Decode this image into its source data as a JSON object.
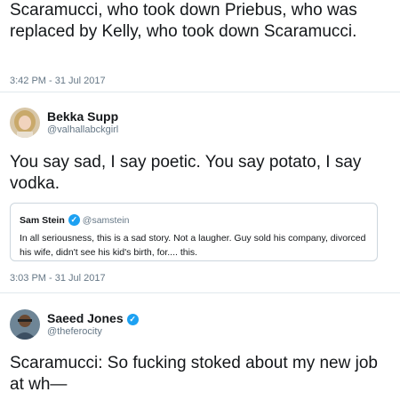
{
  "tweet_top": {
    "text": "Scaramucci, who took down Priebus, who was replaced by Kelly, who took down Scaramucci.",
    "timestamp": "3:42 PM - 31 Jul 2017"
  },
  "tweet_bekka": {
    "name": "Bekka Supp",
    "handle": "@valhallabckgirl",
    "text": "You say sad, I say poetic. You say potato, I say vodka.",
    "timestamp": "3:03 PM - 31 Jul 2017",
    "quoted": {
      "name": "Sam Stein",
      "handle": "@samstein",
      "text": "In all seriousness, this is a sad story. Not a laugher. Guy sold his company, divorced his wife, didn't see his kid's birth, for.... this."
    }
  },
  "tweet_saeed": {
    "name": "Saeed Jones",
    "handle": "@theferocity",
    "text": "Scaramucci: So fucking stoked about my new job at wh—"
  },
  "colors": {
    "verified": "#1da1f2",
    "meta": "#657786",
    "divider": "#e1e8ed"
  },
  "icons": {
    "verified": "verified-badge-icon"
  }
}
